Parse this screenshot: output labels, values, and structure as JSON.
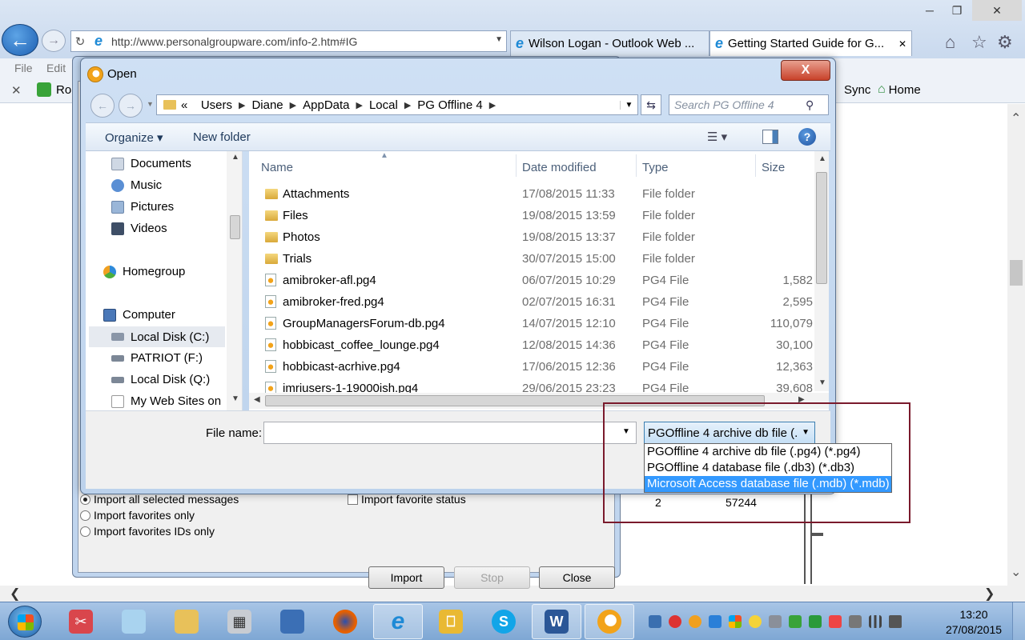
{
  "browser": {
    "address_url": "http://www.personalgroupware.com/info-2.htm#IG",
    "tabs": [
      {
        "label": "Wilson Logan - Outlook Web ..."
      },
      {
        "label": "Getting Started Guide for G..."
      }
    ],
    "menu": {
      "file": "File",
      "edit": "Edit"
    },
    "favorites": {
      "ro": "Ro",
      "sync": "Sync",
      "home": "Home"
    }
  },
  "open_dialog": {
    "title": "Open",
    "close_glyph": "X",
    "breadcrumb": [
      "«",
      "Users",
      "Diane",
      "AppData",
      "Local",
      "PG Offline 4"
    ],
    "search_placeholder": "Search PG Offline 4",
    "toolbar": {
      "organize": "Organize ▾",
      "new_folder": "New folder"
    },
    "nav_pane": [
      {
        "label": "Documents",
        "icon": "documents-icon"
      },
      {
        "label": "Music",
        "icon": "music-icon"
      },
      {
        "label": "Pictures",
        "icon": "pictures-icon"
      },
      {
        "label": "Videos",
        "icon": "videos-icon"
      },
      {
        "label": "Homegroup",
        "icon": "homegroup-icon"
      },
      {
        "label": "Computer",
        "icon": "computer-icon"
      },
      {
        "label": "Local Disk (C:)",
        "icon": "local-disk-icon"
      },
      {
        "label": "PATRIOT (F:)",
        "icon": "drive-icon"
      },
      {
        "label": "Local Disk (Q:)",
        "icon": "drive-icon"
      },
      {
        "label": "My Web Sites on",
        "icon": "web-sites-icon"
      }
    ],
    "columns": {
      "name": "Name",
      "date": "Date modified",
      "type": "Type",
      "size": "Size"
    },
    "files": [
      {
        "name": "Attachments",
        "date": "17/08/2015 11:33",
        "type": "File folder",
        "size": "",
        "kind": "folder"
      },
      {
        "name": "Files",
        "date": "19/08/2015 13:59",
        "type": "File folder",
        "size": "",
        "kind": "folder"
      },
      {
        "name": "Photos",
        "date": "19/08/2015 13:37",
        "type": "File folder",
        "size": "",
        "kind": "folder"
      },
      {
        "name": "Trials",
        "date": "30/07/2015 15:00",
        "type": "File folder",
        "size": "",
        "kind": "folder"
      },
      {
        "name": "amibroker-afl.pg4",
        "date": "06/07/2015 10:29",
        "type": "PG4 File",
        "size": "1,582",
        "kind": "pg4"
      },
      {
        "name": "amibroker-fred.pg4",
        "date": "02/07/2015 16:31",
        "type": "PG4 File",
        "size": "2,595",
        "kind": "pg4"
      },
      {
        "name": "GroupManagersForum-db.pg4",
        "date": "14/07/2015 12:10",
        "type": "PG4 File",
        "size": "110,079",
        "kind": "pg4"
      },
      {
        "name": "hobbicast_coffee_lounge.pg4",
        "date": "12/08/2015 14:36",
        "type": "PG4 File",
        "size": "30,100",
        "kind": "pg4"
      },
      {
        "name": "hobbicast-acrhive.pg4",
        "date": "17/06/2015 12:36",
        "type": "PG4 File",
        "size": "12,363",
        "kind": "pg4"
      },
      {
        "name": "imriusers-1-19000ish.pg4",
        "date": "29/06/2015 23:23",
        "type": "PG4 File",
        "size": "39,608",
        "kind": "pg4"
      }
    ],
    "file_name_label": "File name:",
    "file_name_value": "",
    "file_type_selected": "PGOffline 4 archive db file (.",
    "file_type_options": [
      "PGOffline 4 archive db file (.pg4) (*.pg4)",
      "PGOffline 4 database file (.db3) (*.db3)",
      "Microsoft Access database file (.mdb) (*.mdb)"
    ]
  },
  "import_dialog": {
    "options": [
      "Import all selected messages",
      "Import favorites only",
      "Import favorites IDs only"
    ],
    "favorite_status": "Import favorite status",
    "buttons": {
      "import": "Import",
      "stop": "Stop",
      "close": "Close"
    },
    "values": [
      "2",
      "57244"
    ]
  },
  "taskbar": {
    "clock_time": "13:20",
    "clock_date": "27/08/2015",
    "apps": [
      "snipping-tool",
      "notepad",
      "file-explorer",
      "calculator",
      "network",
      "firefox",
      "internet-explorer",
      "lock",
      "skype",
      "word",
      "pg-offline"
    ]
  },
  "colors": {
    "highlight_border": "#7a1a2c",
    "selection": "#3399ff",
    "ie_blue": "#1e8ad6"
  }
}
